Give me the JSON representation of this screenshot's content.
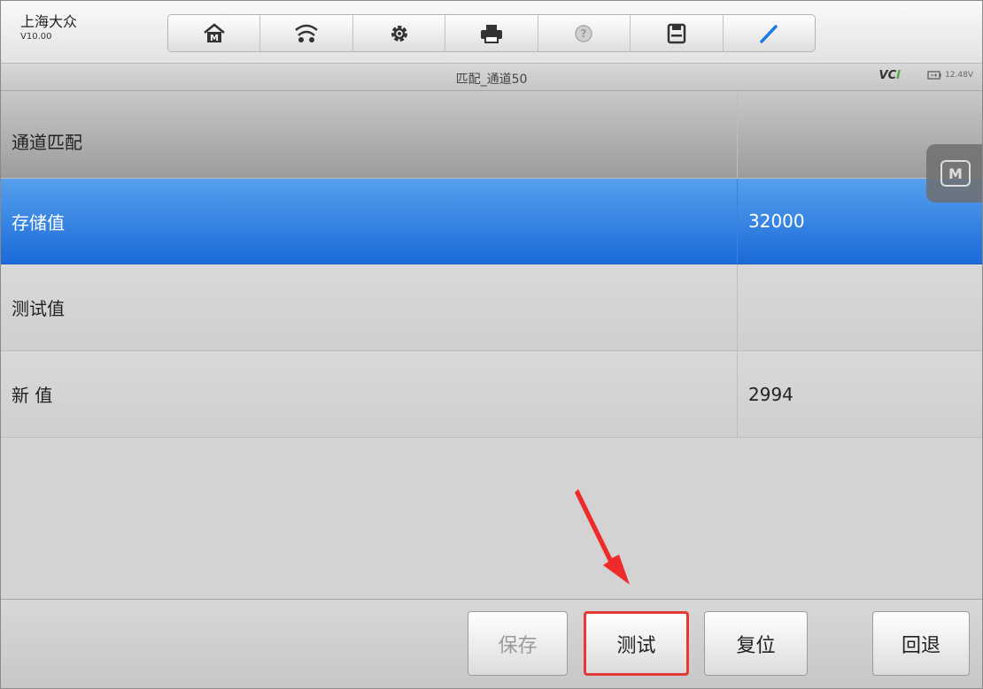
{
  "header": {
    "brand_name": "上海大众",
    "version": "V10.00"
  },
  "toolbar": {
    "buttons": [
      {
        "name": "home-icon"
      },
      {
        "name": "vehicle-icon"
      },
      {
        "name": "settings-icon"
      },
      {
        "name": "print-icon"
      },
      {
        "name": "help-icon"
      },
      {
        "name": "save-icon"
      },
      {
        "name": "edit-icon"
      }
    ]
  },
  "titlebar": {
    "title": "匹配_通道50",
    "vci_label": "VC",
    "vci_suffix": "I",
    "battery_voltage": "12.48V"
  },
  "table": {
    "rows": [
      {
        "label": "通道匹配",
        "value": ""
      },
      {
        "label": "存储值",
        "value": "32000"
      },
      {
        "label": "测试值",
        "value": ""
      },
      {
        "label": "新 值",
        "value": "2994"
      }
    ]
  },
  "floating": {
    "label": "M"
  },
  "footer": {
    "save_label": "保存",
    "test_label": "测试",
    "reset_label": "复位",
    "back_label": "回退"
  },
  "colors": {
    "selected_row": "#1b6ad8",
    "highlight_border": "#e53935",
    "vci_accent": "#4db33d"
  }
}
